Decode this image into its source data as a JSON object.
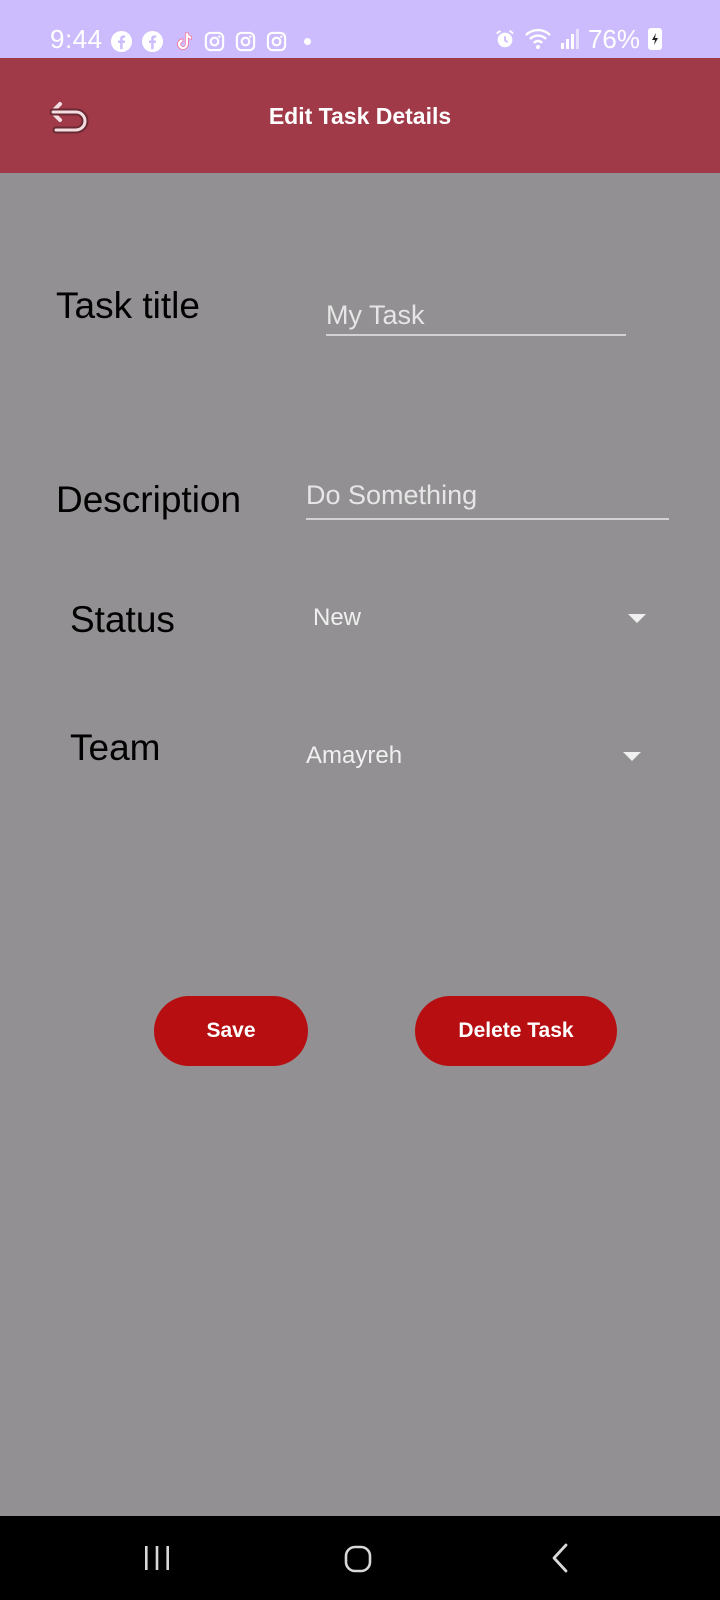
{
  "status_bar": {
    "time": "9:44",
    "battery": "76%",
    "notification_icons": [
      "facebook-icon",
      "facebook-icon",
      "tiktok-icon",
      "instagram-icon",
      "instagram-icon",
      "instagram-icon"
    ],
    "system_icons": [
      "alarm-icon",
      "wifi-icon",
      "signal-icon",
      "battery-icon"
    ],
    "background_color": "#cdbcfd"
  },
  "app_bar": {
    "title": "Edit Task Details",
    "back_icon": "undo-arrow-icon",
    "background_color": "#a13a48"
  },
  "form": {
    "task_title": {
      "label": "Task title",
      "value": "My Task"
    },
    "description": {
      "label": "Description",
      "value": "Do Something"
    },
    "status": {
      "label": "Status",
      "selected": "New"
    },
    "team": {
      "label": "Team",
      "selected": "Amayreh"
    }
  },
  "actions": {
    "save_label": "Save",
    "delete_label": "Delete Task",
    "button_color": "#b70f11"
  },
  "nav_bar": {
    "buttons": [
      "recents-icon",
      "home-icon",
      "back-icon"
    ]
  },
  "colors": {
    "page_background": "#929092"
  }
}
